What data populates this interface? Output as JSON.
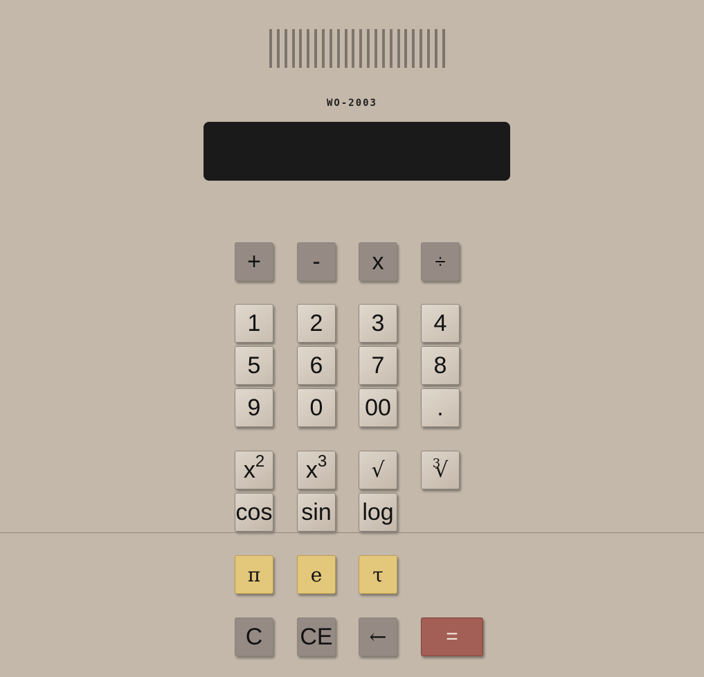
{
  "model": "WO-2003",
  "display": {
    "value": ""
  },
  "keys": {
    "plus": "+",
    "minus": "-",
    "multiply": "x",
    "divide": "÷",
    "d1": "1",
    "d2": "2",
    "d3": "3",
    "d4": "4",
    "d5": "5",
    "d6": "6",
    "d7": "7",
    "d8": "8",
    "d9": "9",
    "d0": "0",
    "d00": "00",
    "dot": ".",
    "square_base": "x",
    "square_exp": "2",
    "cube_base": "x",
    "cube_exp": "3",
    "sqrt": "√",
    "cbrt_index": "3",
    "cbrt_sign": "√",
    "cos": "cos",
    "sin": "sin",
    "log": "log",
    "pi": "π",
    "e": "e",
    "tau": "τ",
    "clear": "C",
    "clear_entry": "CE",
    "backspace": "←",
    "equals": "="
  },
  "colors": {
    "body": "#c4b8aa",
    "display": "#1a1a1a",
    "operator_key": "#958b84",
    "constant_key": "#e3c77a",
    "equals_key": "#a35f55"
  }
}
